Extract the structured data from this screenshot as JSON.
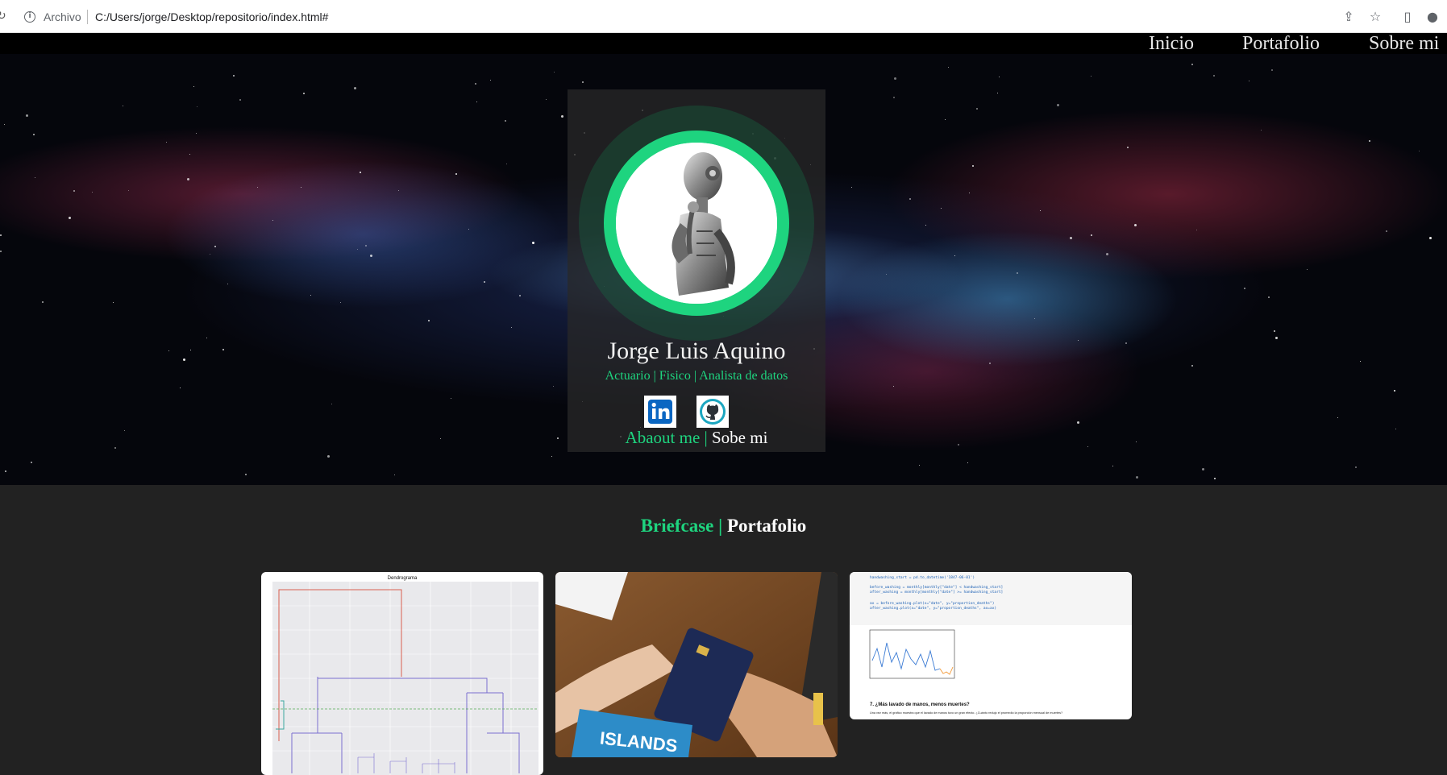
{
  "browser": {
    "reload_glyph": "↻",
    "scheme": "Archivo",
    "url": "C:/Users/jorge/Desktop/repositorio/index.html#"
  },
  "nav": {
    "inicio": "Inicio",
    "portafolio": "Portafolio",
    "sobre_mi": "Sobre mi"
  },
  "profile": {
    "name": "Jorge Luis Aquino",
    "roles": "Actuario | Fisico | Analista de datos",
    "about_en": "Abaout me |",
    "about_es": "Sobe mi",
    "social": [
      {
        "icon": "linkedin-icon",
        "label": "in"
      },
      {
        "icon": "github-icon",
        "label": ""
      }
    ]
  },
  "portfolio": {
    "title_en": "Briefcase |",
    "title_es": "Portafolio",
    "thumb1_title": "Dendrograma",
    "thumb2_text": "ISLANDS",
    "thumb3_heading": "7. ¿Más lavado de manos, menos muertes?",
    "thumb3_caption": "Una vez más, el gráfico muestra que el lavado de manos tuvo un gran efecto. ¿Cuánto redujo el promedio la proporción mensual de muertes?"
  },
  "colors": {
    "accent": "#1ed47f",
    "page_bg": "#222222",
    "card_bg": "#282828"
  }
}
